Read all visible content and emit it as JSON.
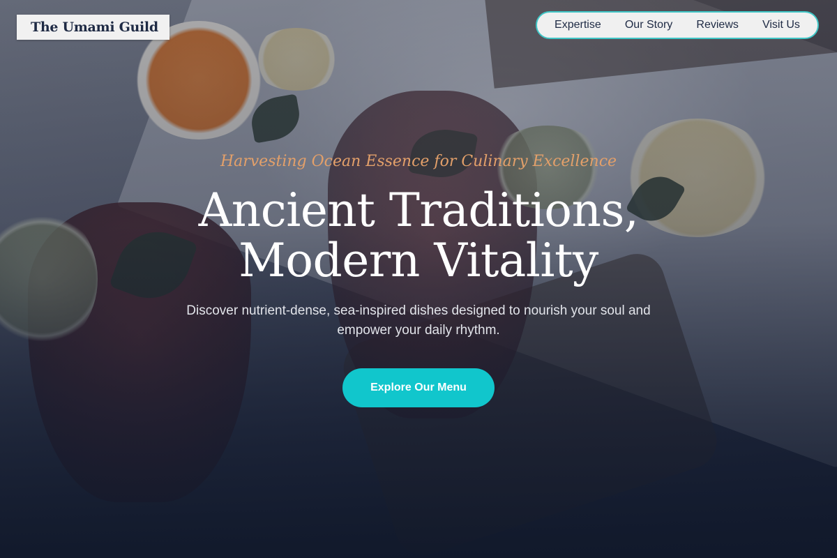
{
  "header": {
    "logo_text": "The Umami Guild",
    "nav": [
      {
        "label": "Expertise"
      },
      {
        "label": "Our Story"
      },
      {
        "label": "Reviews"
      },
      {
        "label": "Visit Us"
      }
    ]
  },
  "hero": {
    "tagline": "Harvesting Ocean Essence for Culinary Excellence",
    "headline_line1": "Ancient Traditions,",
    "headline_line2": "Modern Vitality",
    "subtitle": "Discover nutrient-dense, sea-inspired dishes designed to nourish your soul and empower your daily rhythm.",
    "cta_label": "Explore Our Menu",
    "background": "photo-drinks-with-citrus-and-mint"
  },
  "colors": {
    "accent": "#11c6cc",
    "tagline": "#e3a06a",
    "nav_border": "#3fc6c6",
    "dark_text": "#1e2a44"
  }
}
